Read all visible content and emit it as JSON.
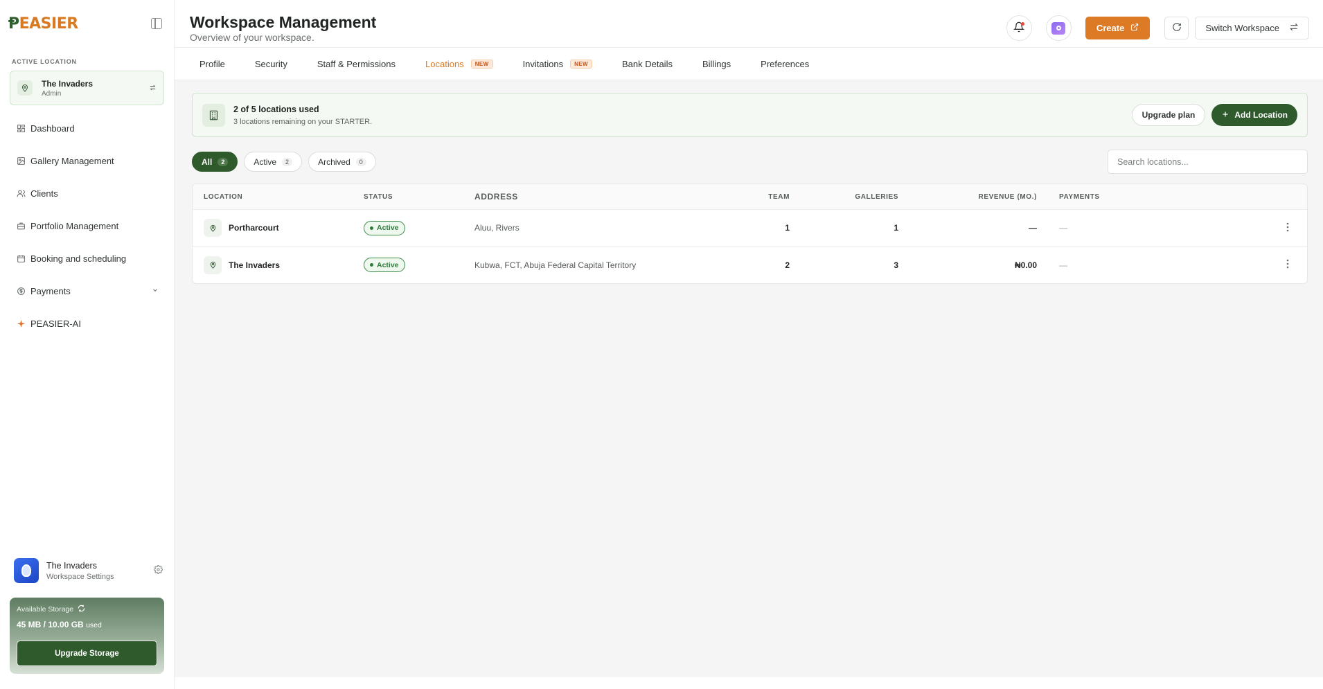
{
  "brand": {
    "logo_text": "PEASIER"
  },
  "sidebar": {
    "section_label": "ACTIVE LOCATION",
    "active_location": {
      "name": "The Invaders",
      "role": "Admin"
    },
    "items": [
      {
        "label": "Dashboard",
        "icon": "dashboard-icon"
      },
      {
        "label": "Gallery Management",
        "icon": "gallery-icon"
      },
      {
        "label": "Clients",
        "icon": "users-icon"
      },
      {
        "label": "Portfolio Management",
        "icon": "portfolio-icon"
      },
      {
        "label": "Booking and scheduling",
        "icon": "calendar-icon"
      },
      {
        "label": "Payments",
        "icon": "dollar-icon"
      },
      {
        "label": "PEASIER-AI",
        "icon": "sparkle-icon"
      }
    ],
    "workspace": {
      "name": "The Invaders",
      "sub": "Workspace Settings"
    },
    "storage": {
      "label": "Available Storage",
      "used": "45 MB / 10.00 GB",
      "used_suffix": "used",
      "button": "Upgrade Storage"
    }
  },
  "header": {
    "title": "Workspace Management",
    "subtitle": "Overview of your workspace.",
    "create_label": "Create",
    "switch_label": "Switch Workspace"
  },
  "tabs": [
    {
      "label": "Profile"
    },
    {
      "label": "Security"
    },
    {
      "label": "Staff & Permissions"
    },
    {
      "label": "Locations",
      "badge": "NEW"
    },
    {
      "label": "Invitations",
      "badge": "NEW"
    },
    {
      "label": "Bank Details"
    },
    {
      "label": "Billings"
    },
    {
      "label": "Preferences"
    }
  ],
  "usage": {
    "title": "2 of 5 locations used",
    "subtitle": "3 locations remaining on your STARTER.",
    "upgrade_label": "Upgrade plan",
    "add_label": "Add Location"
  },
  "filters": [
    {
      "label": "All",
      "count": "2"
    },
    {
      "label": "Active",
      "count": "2"
    },
    {
      "label": "Archived",
      "count": "0"
    }
  ],
  "search": {
    "placeholder": "Search locations..."
  },
  "table": {
    "columns": [
      "LOCATION",
      "STATUS",
      "ADDRESS",
      "TEAM",
      "GALLERIES",
      "REVENUE (MO.)",
      "PAYMENTS"
    ],
    "rows": [
      {
        "location": "Portharcourt",
        "status": "Active",
        "address": "Aluu, Rivers",
        "team": "1",
        "galleries": "1",
        "revenue": "—",
        "payments": "—"
      },
      {
        "location": "The Invaders",
        "status": "Active",
        "address": "Kubwa, FCT, Abuja Federal Capital Territory",
        "team": "2",
        "galleries": "3",
        "revenue": "₦0.00",
        "payments": "—"
      }
    ]
  },
  "colors": {
    "accent": "#dd7a25",
    "brand_green": "#2f5a2c",
    "active_status": "#2f7b3d"
  }
}
